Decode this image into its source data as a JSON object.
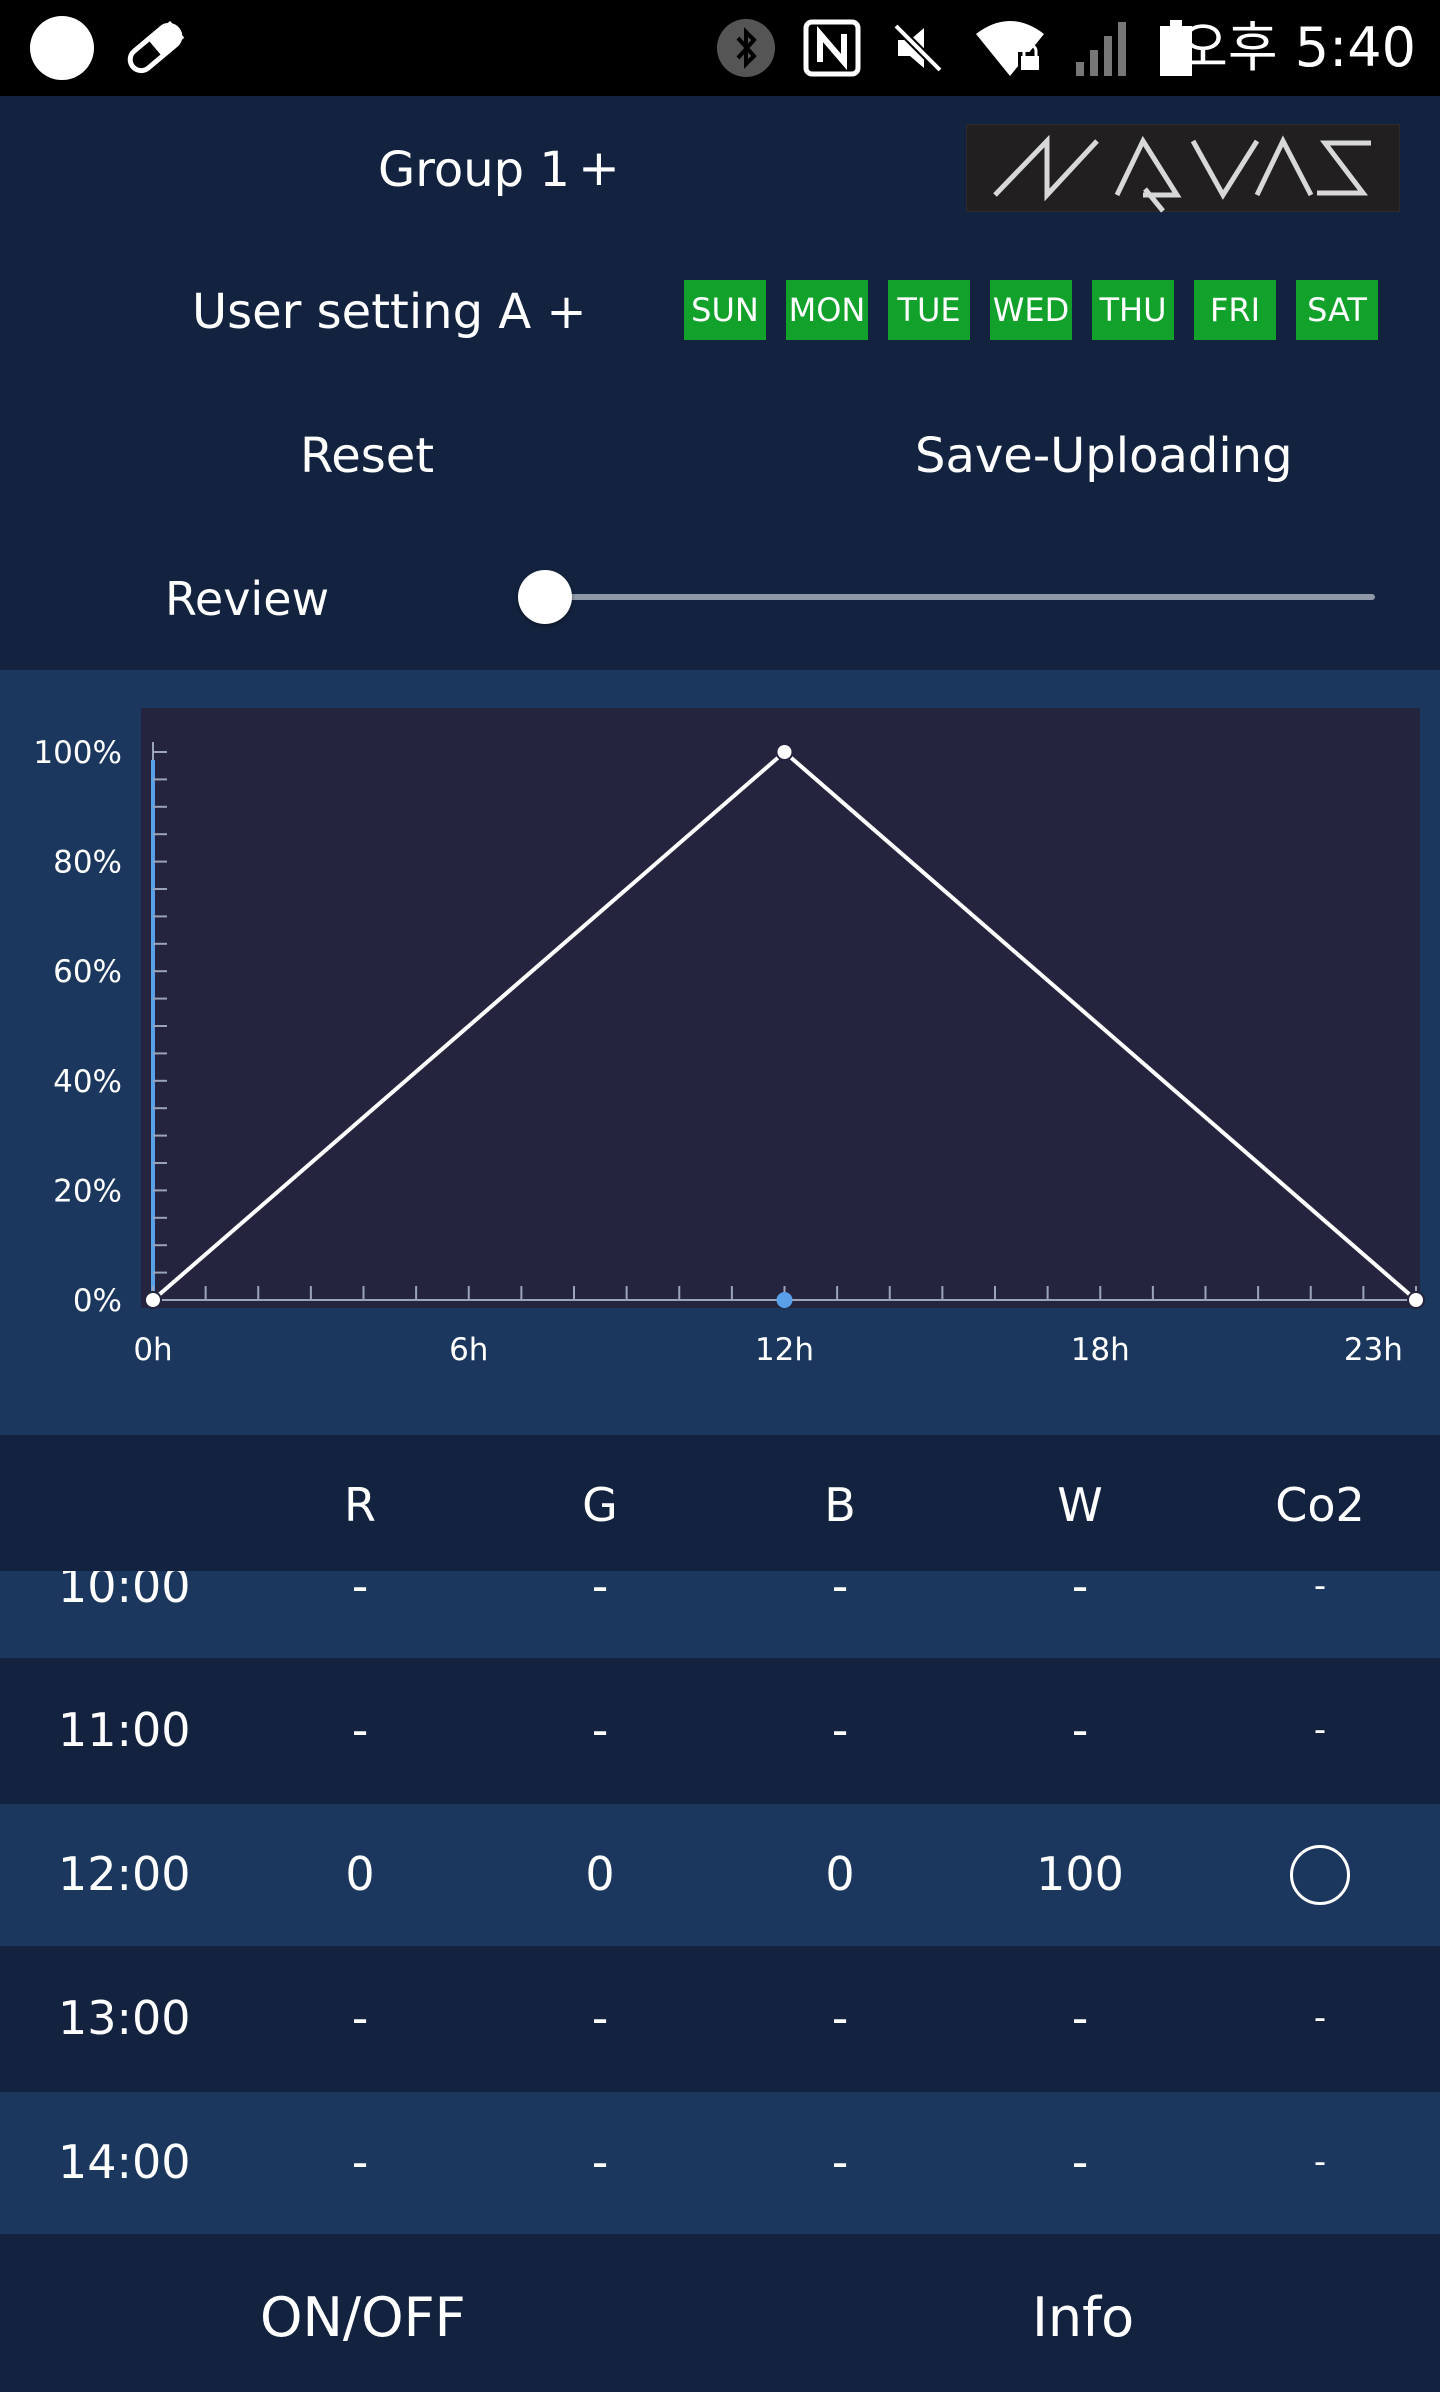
{
  "statusbar": {
    "time": "오후 5:40",
    "icons": [
      "circle-icon",
      "pill-icon",
      "bluetooth-icon",
      "nfc-icon",
      "mute-icon",
      "wifi-locked-icon",
      "signal-icon",
      "battery-icon"
    ]
  },
  "header": {
    "group_label": "Group 1",
    "group_add": "+",
    "logo_text": "AQVAS",
    "user_setting": "User setting A +",
    "days": [
      "SUN",
      "MON",
      "TUE",
      "WED",
      "THU",
      "FRI",
      "SAT"
    ],
    "day_active_color": "#12a12a",
    "reset_label": "Reset",
    "save_label": "Save-Uploading",
    "review_label": "Review",
    "review_value": 0
  },
  "chart_data": {
    "type": "line",
    "x": [
      0,
      12,
      24
    ],
    "values": [
      0,
      100,
      0
    ],
    "selected_x": 12,
    "xlim": [
      0,
      24
    ],
    "ylim": [
      0,
      100
    ],
    "x_ticks": [
      "0h",
      "6h",
      "12h",
      "18h",
      "23h"
    ],
    "y_ticks": [
      "0%",
      "20%",
      "40%",
      "60%",
      "80%",
      "100%"
    ],
    "grid": false
  },
  "table": {
    "headers": [
      "R",
      "G",
      "B",
      "W",
      "Co2"
    ],
    "rows": [
      {
        "time": "10:00",
        "r": "-",
        "g": "-",
        "b": "-",
        "w": "-",
        "co2": "-"
      },
      {
        "time": "11:00",
        "r": "-",
        "g": "-",
        "b": "-",
        "w": "-",
        "co2": "-"
      },
      {
        "time": "12:00",
        "r": "0",
        "g": "0",
        "b": "0",
        "w": "100",
        "co2": "circle"
      },
      {
        "time": "13:00",
        "r": "-",
        "g": "-",
        "b": "-",
        "w": "-",
        "co2": "-"
      },
      {
        "time": "14:00",
        "r": "-",
        "g": "-",
        "b": "-",
        "w": "-",
        "co2": "-"
      }
    ]
  },
  "footer": {
    "onoff_label": "ON/OFF",
    "info_label": "Info"
  },
  "colors": {
    "background": "#13233f",
    "panel": "#1b375d",
    "chart_plot": "#25243e",
    "accent_blue": "#5aa0e8"
  }
}
